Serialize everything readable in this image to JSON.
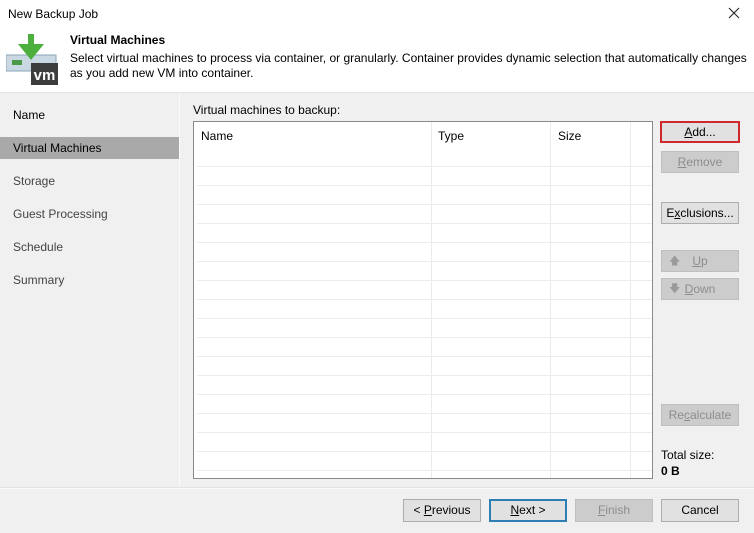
{
  "window": {
    "title": "New Backup Job",
    "close_icon": "close-icon"
  },
  "header": {
    "icon": "vm-download-icon",
    "title": "Virtual Machines",
    "description": "Select virtual machines to process via container, or granularly. Container provides dynamic selection that automatically changes as you add new VM into container."
  },
  "sidebar": {
    "items": [
      {
        "label": "Name",
        "state": "completed"
      },
      {
        "label": "Virtual Machines",
        "state": "active"
      },
      {
        "label": "Storage",
        "state": "pending"
      },
      {
        "label": "Guest Processing",
        "state": "pending"
      },
      {
        "label": "Schedule",
        "state": "pending"
      },
      {
        "label": "Summary",
        "state": "pending"
      }
    ]
  },
  "main": {
    "section_label": "Virtual machines to backup:",
    "table": {
      "columns": [
        "Name",
        "Type",
        "Size"
      ],
      "rows": []
    },
    "buttons": {
      "add": {
        "pre": "",
        "ul": "A",
        "post": "dd...",
        "enabled": true
      },
      "remove": {
        "pre": "",
        "ul": "R",
        "post": "emove",
        "enabled": false
      },
      "exclusions": {
        "pre": "E",
        "ul": "x",
        "post": "clusions...",
        "enabled": true
      },
      "up": {
        "pre": "",
        "ul": "U",
        "post": "p",
        "enabled": false,
        "icon": "arrow-up-icon"
      },
      "down": {
        "pre": "",
        "ul": "D",
        "post": "own",
        "enabled": false,
        "icon": "arrow-down-icon"
      },
      "recalculate": {
        "pre": "Re",
        "ul": "c",
        "post": "alculate",
        "enabled": false
      }
    },
    "total_size_label": "Total size:",
    "total_size_value": "0 B"
  },
  "footer": {
    "previous": {
      "pre": "< ",
      "ul": "P",
      "post": "revious"
    },
    "next": {
      "pre": "",
      "ul": "N",
      "post": "ext >"
    },
    "finish": {
      "pre": "",
      "ul": "F",
      "post": "inish"
    },
    "cancel": {
      "label": "Cancel"
    }
  },
  "colors": {
    "highlight_border": "#d0262d",
    "default_button_border": "#2e7db4",
    "active_nav_bg": "#a9a9a9",
    "logo_green": "#4caf3e",
    "logo_dark": "#3c3c3c"
  }
}
